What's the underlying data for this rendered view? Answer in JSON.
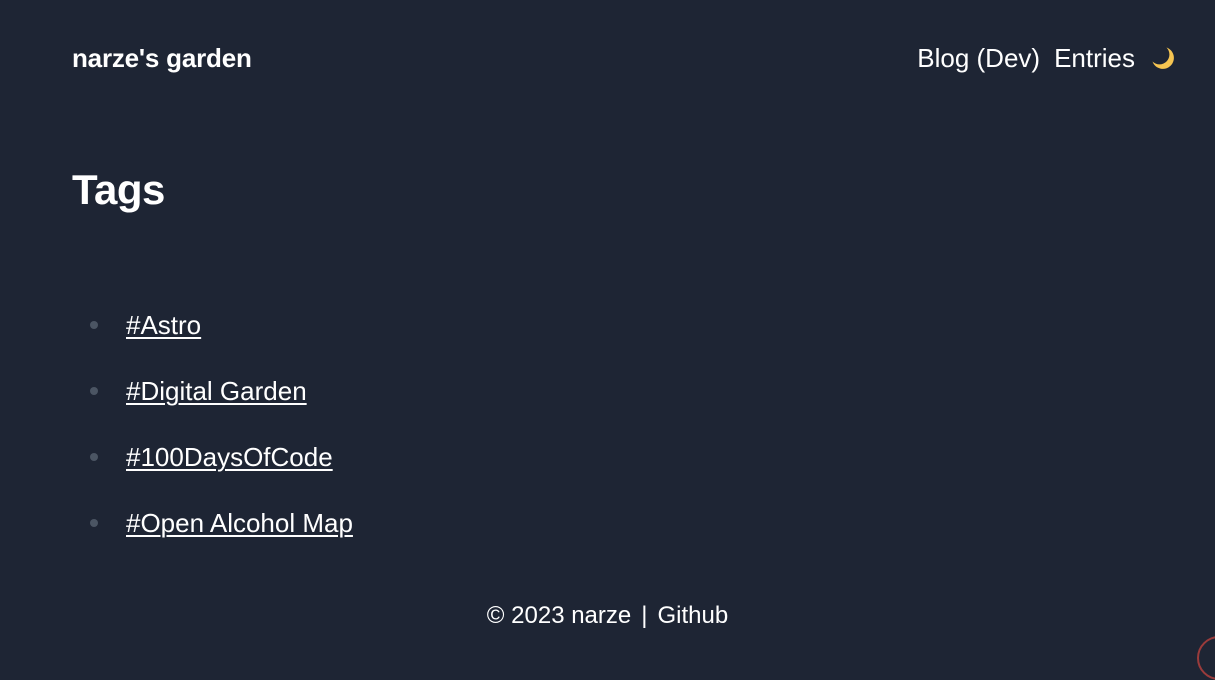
{
  "header": {
    "site_title": "narze's garden",
    "nav": [
      {
        "label": "Blog (Dev)"
      },
      {
        "label": "Entries"
      }
    ],
    "theme_toggle_icon": "moon-icon"
  },
  "main": {
    "title": "Tags",
    "tags": [
      {
        "label": "#Astro"
      },
      {
        "label": "#Digital Garden"
      },
      {
        "label": "#100DaysOfCode"
      },
      {
        "label": "#Open Alcohol Map"
      }
    ]
  },
  "footer": {
    "copyright": "© 2023 narze",
    "separator": "|",
    "github_label": "Github"
  },
  "colors": {
    "background": "#1e2534",
    "text": "#ffffff",
    "bullet": "#4b5563",
    "moon": "#f5c451"
  }
}
